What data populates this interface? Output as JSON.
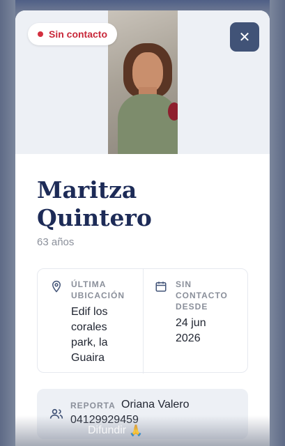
{
  "status": {
    "label": "Sin contacto",
    "color": "#c8283a"
  },
  "close": {
    "icon": "close-icon",
    "glyph": "✕"
  },
  "person": {
    "first_name": "Maritza",
    "last_name": "Quintero",
    "age": "63 años"
  },
  "last_location": {
    "label_line1": "ÚLTIMA",
    "label_line2": "UBICACIÓN",
    "value_line1": "Edif los",
    "value_line2": "corales",
    "value_line3": "park, la",
    "value_line4": "Guaira",
    "icon": "location-pin-icon"
  },
  "no_contact": {
    "label_line1": "SIN",
    "label_line2": "CONTACTO",
    "label_line3": "DESDE",
    "value_line1": "24 jun",
    "value_line2": "2026",
    "icon": "calendar-icon"
  },
  "reporter": {
    "label": "REPORTA",
    "name": "Oriana Valero",
    "phone": "04129929459",
    "icon": "people-icon"
  },
  "share": {
    "label": "Difundir",
    "icon": "praying-hands-icon",
    "glyph": "🙏"
  },
  "colors": {
    "accent": "#415377",
    "title": "#1d2b57"
  }
}
